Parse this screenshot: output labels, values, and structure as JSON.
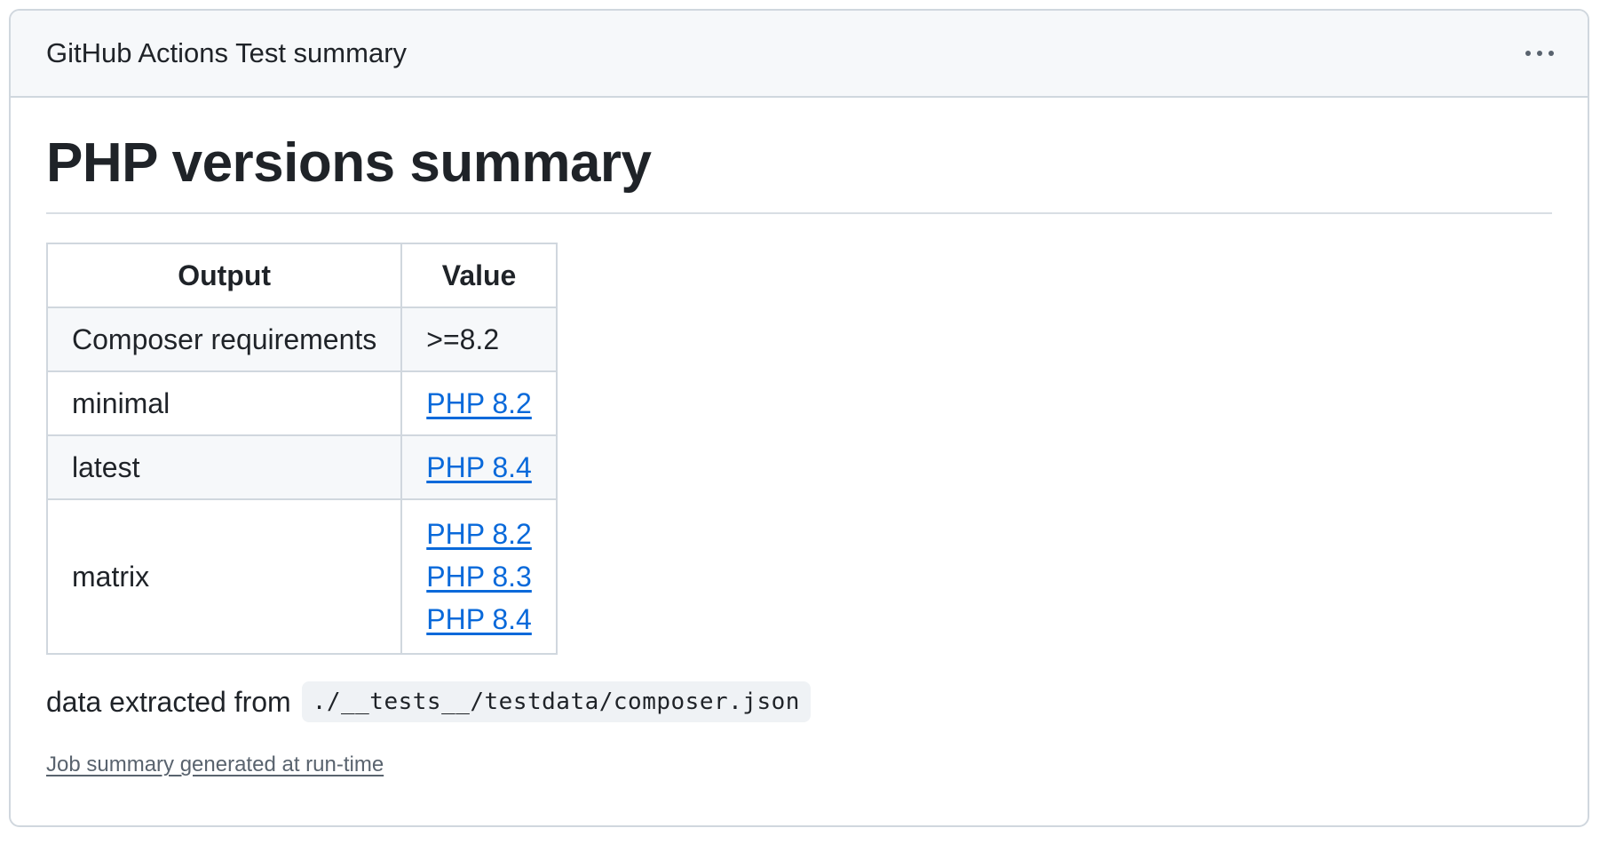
{
  "header": {
    "title": "GitHub Actions Test summary",
    "menu_icon": "kebab-horizontal-icon"
  },
  "main": {
    "heading": "PHP versions summary",
    "table": {
      "columns": [
        "Output",
        "Value"
      ],
      "rows": [
        {
          "output": "Composer requirements",
          "values": [
            ">=8.2"
          ],
          "links": false
        },
        {
          "output": "minimal",
          "values": [
            "PHP 8.2"
          ],
          "links": true
        },
        {
          "output": "latest",
          "values": [
            "PHP 8.4"
          ],
          "links": true
        },
        {
          "output": "matrix",
          "values": [
            "PHP 8.2",
            "PHP 8.3",
            "PHP 8.4"
          ],
          "links": true
        }
      ]
    },
    "source_text": "data extracted from",
    "source_path": "./__tests__/testdata/composer.json",
    "generated_note": "Job summary generated at run-time"
  },
  "colors": {
    "link": "#0969da",
    "border": "#d0d7de",
    "header_bg": "#f6f8fa"
  }
}
